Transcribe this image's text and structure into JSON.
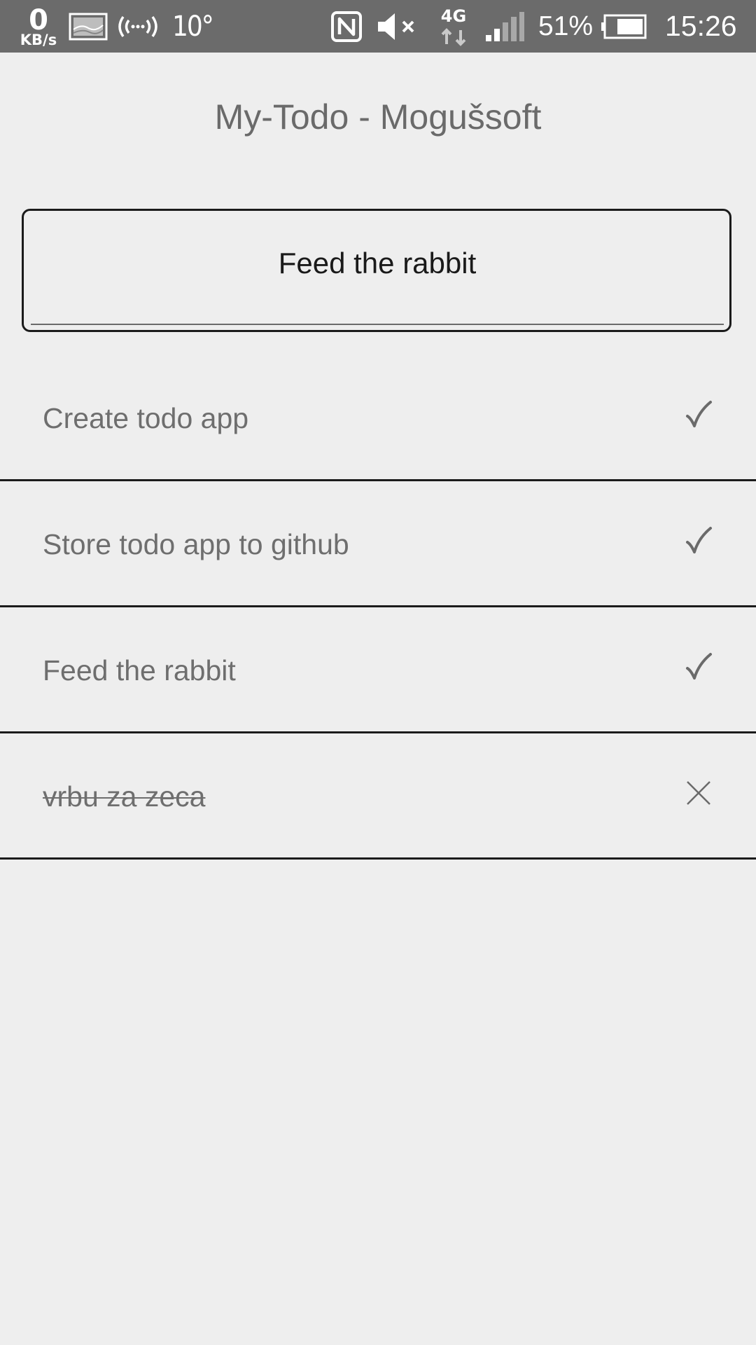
{
  "status_bar": {
    "net_speed_value": "0",
    "net_speed_unit": "KB/s",
    "temperature": "10°",
    "battery_percent": "51%",
    "time": "15:26",
    "network_type": "4G",
    "icons": [
      "image-notification-icon",
      "hotspot-icon",
      "nfc-icon",
      "mute-icon",
      "lte-icon",
      "signal-icon",
      "battery-icon"
    ]
  },
  "app": {
    "title": "My-Todo - Mogušsoft"
  },
  "new_todo": {
    "value": "Feed the rabbit"
  },
  "todos": [
    {
      "text": "Create todo app",
      "completed": false,
      "action_icon": "check-icon"
    },
    {
      "text": "Store todo app to github",
      "completed": false,
      "action_icon": "check-icon"
    },
    {
      "text": "Feed the rabbit",
      "completed": false,
      "action_icon": "check-icon"
    },
    {
      "text": "vrbu za zeca",
      "completed": true,
      "action_icon": "close-icon"
    }
  ],
  "colors": {
    "background": "#eeeeee",
    "status_bar": "#6b6b6b",
    "text_muted": "#6e6e6e",
    "border": "#1b1b1b"
  }
}
